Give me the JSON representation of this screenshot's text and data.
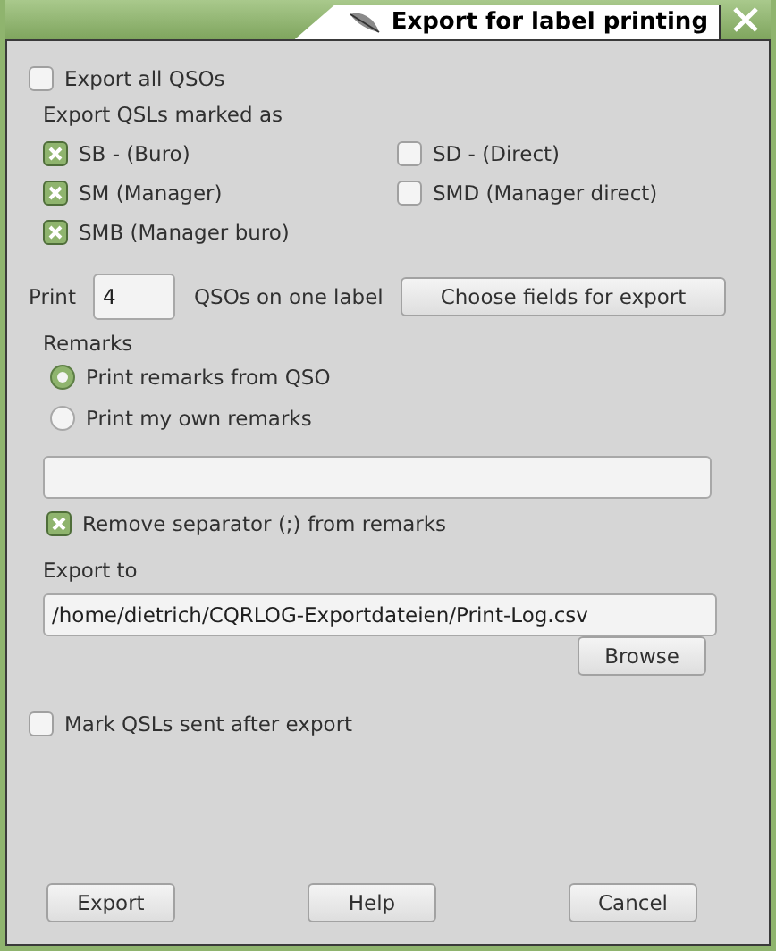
{
  "window": {
    "title": "Export for label printing"
  },
  "export_all": {
    "label": "Export all QSOs",
    "checked": false
  },
  "marked_as": {
    "label": "Export QSLs marked as",
    "options": [
      {
        "label": "SB - (Buro)",
        "checked": true
      },
      {
        "label": "SD - (Direct)",
        "checked": false
      },
      {
        "label": "SM  (Manager)",
        "checked": true
      },
      {
        "label": "SMD (Manager direct)",
        "checked": false
      },
      {
        "label": "SMB (Manager buro)",
        "checked": true
      }
    ]
  },
  "print": {
    "label": "Print",
    "value": "4",
    "suffix": "QSOs on one label",
    "button": "Choose fields for export"
  },
  "remarks": {
    "label": "Remarks",
    "options": [
      {
        "label": "Print remarks from QSO",
        "selected": true
      },
      {
        "label": "Print my own remarks",
        "selected": false
      }
    ],
    "remove_separator": {
      "label": "Remove separator (;) from remarks",
      "checked": true
    }
  },
  "export_to": {
    "label": "Export to",
    "path": "/home/dietrich/CQRLOG-Exportdateien/Print-Log.csv",
    "button": "Browse"
  },
  "mark_sent": {
    "label": "Mark QSLs sent after export",
    "checked": false
  },
  "buttons": [
    "Export",
    "Help",
    "Cancel"
  ]
}
